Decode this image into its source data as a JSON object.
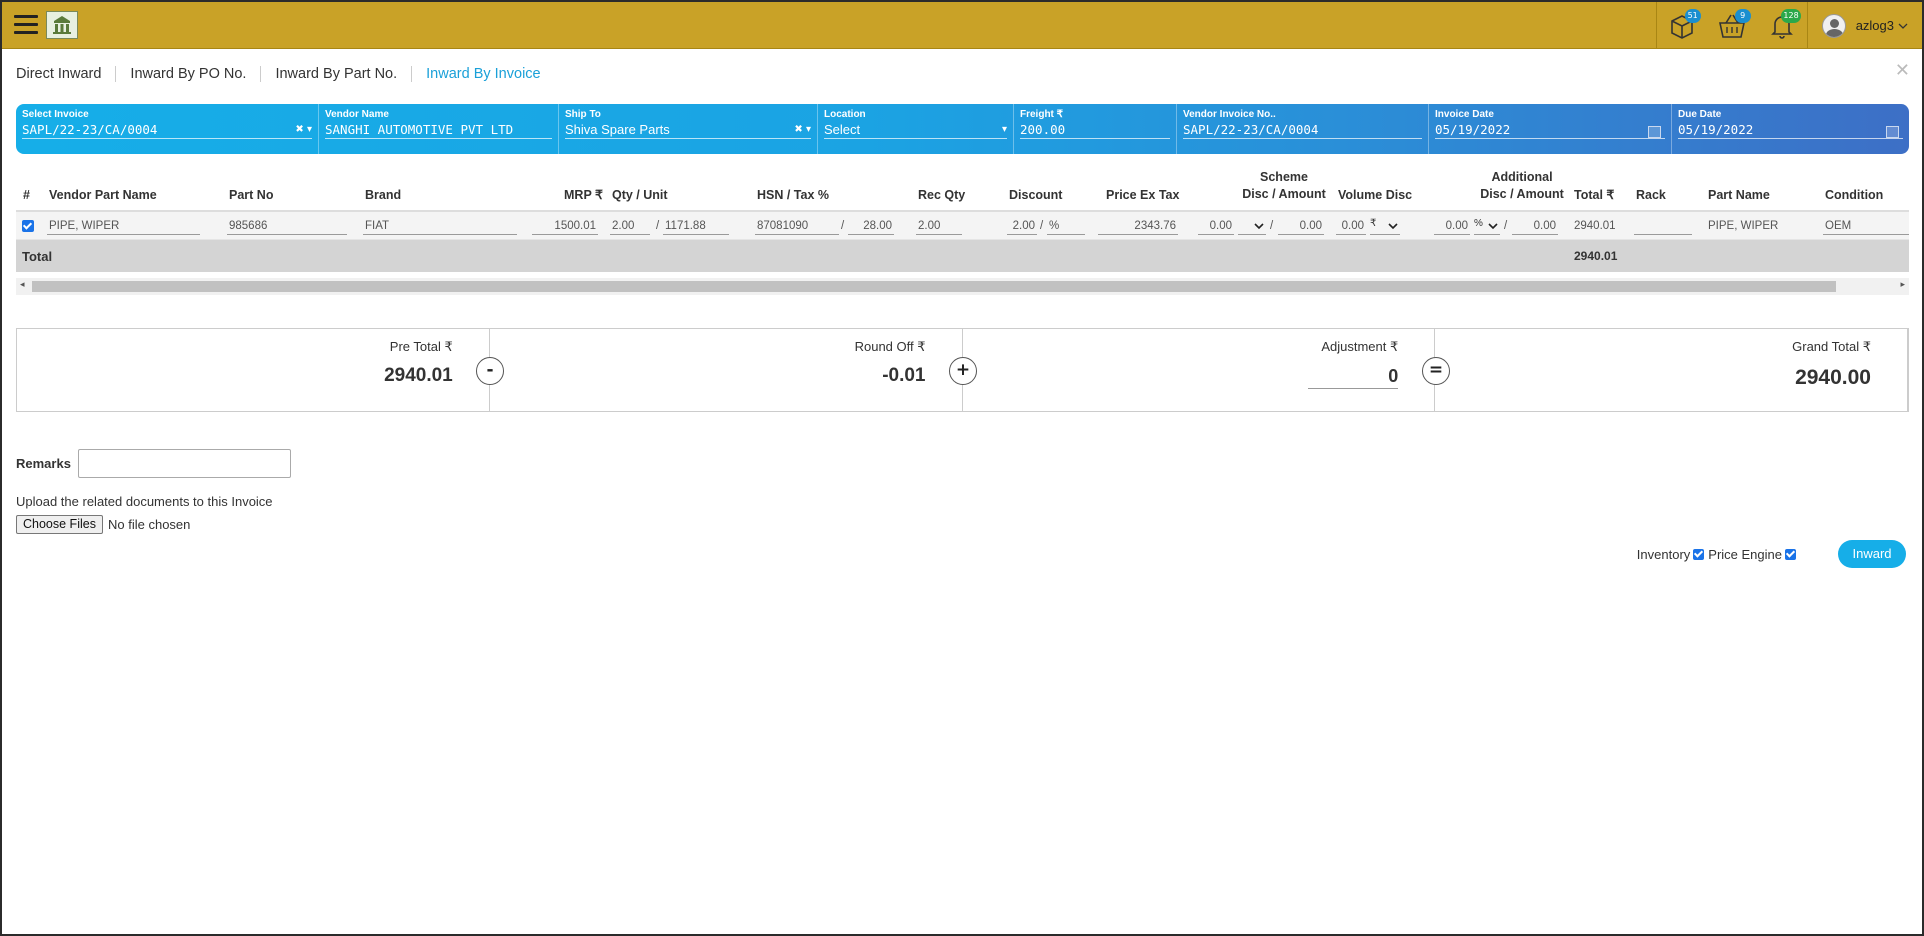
{
  "header": {
    "badges": {
      "packages": "51",
      "cart": "9",
      "notifications": "128"
    },
    "user": "azlog3"
  },
  "tabs": [
    "Direct Inward",
    "Inward By PO No.",
    "Inward By Part No.",
    "Inward By Invoice"
  ],
  "active_tab": "Inward By Invoice",
  "filters": {
    "select_invoice": {
      "label": "Select Invoice",
      "value": "SAPL/22-23/CA/0004"
    },
    "vendor_name": {
      "label": "Vendor Name",
      "value": "SANGHI AUTOMOTIVE PVT LTD"
    },
    "ship_to": {
      "label": "Ship To",
      "value": "Shiva Spare Parts"
    },
    "location": {
      "label": "Location",
      "value": "Select"
    },
    "freight": {
      "label": "Freight ₹",
      "value": "200.00"
    },
    "vendor_invoice_no": {
      "label": "Vendor Invoice No..",
      "value": "SAPL/22-23/CA/0004"
    },
    "invoice_date": {
      "label": "Invoice Date",
      "value": "05/19/2022"
    },
    "due_date": {
      "label": "Due Date",
      "value": "05/19/2022"
    }
  },
  "table": {
    "headers": {
      "num": "#",
      "vendor_part_name": "Vendor Part Name",
      "part_no": "Part No",
      "brand": "Brand",
      "mrp": "MRP ₹",
      "qty_unit": "Qty / Unit",
      "hsn_tax": "HSN / Tax %",
      "rec_qty": "Rec Qty",
      "discount": "Discount",
      "price_ex_tax": "Price Ex Tax",
      "scheme_1": "Scheme",
      "scheme_2": "Disc / Amount",
      "volume_disc": "Volume Disc",
      "additional_1": "Additional",
      "additional_2": "Disc / Amount",
      "total": "Total ₹",
      "rack": "Rack",
      "part_name": "Part Name",
      "condition": "Condition"
    },
    "rows": [
      {
        "vendor_part_name": "PIPE, WIPER",
        "part_no": "985686",
        "brand": "FIAT",
        "mrp": "1500.01",
        "qty": "2.00",
        "unit": "1171.88",
        "hsn": "87081090",
        "tax": "28.00",
        "rec_qty": "2.00",
        "discount": "2.00",
        "discount_unit": "%",
        "price_ex_tax": "2343.76",
        "scheme_disc": "0.00",
        "scheme_amount": "0.00",
        "volume_disc": "0.00",
        "volume_unit": "₹",
        "additional_disc": "0.00",
        "additional_unit": "%",
        "additional_amount": "0.00",
        "total": "2940.01",
        "rack": "",
        "part_name": "PIPE, WIPER",
        "condition": "OEM"
      }
    ],
    "total_label": "Total",
    "total_value": "2940.01"
  },
  "summary": {
    "pre_total_label": "Pre Total ₹",
    "pre_total": "2940.01",
    "round_off_label": "Round Off ₹",
    "round_off": "-0.01",
    "adjustment_label": "Adjustment ₹",
    "adjustment": "0",
    "grand_total_label": "Grand Total ₹",
    "grand_total": "2940.00",
    "ops": [
      "-",
      "+",
      "="
    ]
  },
  "remarks_label": "Remarks",
  "upload": {
    "text": "Upload the related documents to this Invoice",
    "button": "Choose Files",
    "status": "No file chosen"
  },
  "options": {
    "inventory": "Inventory",
    "price_engine": "Price Engine"
  },
  "inward_button": "Inward",
  "colors": {
    "topbar": "#c9a227",
    "accent": "#16aee8",
    "strip_end": "#3d6fc6"
  }
}
